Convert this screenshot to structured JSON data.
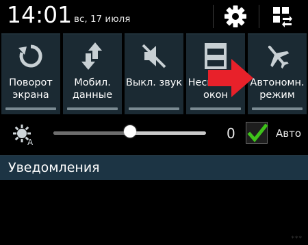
{
  "status": {
    "time": "14:01",
    "date": "вс, 17 июля"
  },
  "header_buttons": [
    {
      "icon": "gear-icon"
    },
    {
      "icon": "grid-switch-icon"
    }
  ],
  "toggles": [
    {
      "label": "Поворот\nэкрана",
      "icon": "rotate-icon",
      "active": false
    },
    {
      "label": "Мобил.\nданные",
      "icon": "mobile-data-icon",
      "active": false
    },
    {
      "label": "Выкл. звук",
      "icon": "mute-icon",
      "active": false
    },
    {
      "label": "Несколько\nокон",
      "icon": "multi-window-icon",
      "active": false
    },
    {
      "label": "Автономн.\nрежим",
      "icon": "airplane-icon",
      "active": false
    }
  ],
  "brightness": {
    "icon": "brightness-auto-icon",
    "level": 0.5,
    "value": "0",
    "auto_checked": true,
    "auto_label": "Авто"
  },
  "notifications": {
    "title": "Уведомления"
  },
  "watermark": "***",
  "colors": {
    "tile_bg": "#1b2a33",
    "notif_bg": "#1c3444",
    "check_green": "#3ec21a",
    "arrow_red": "#e8212a"
  }
}
